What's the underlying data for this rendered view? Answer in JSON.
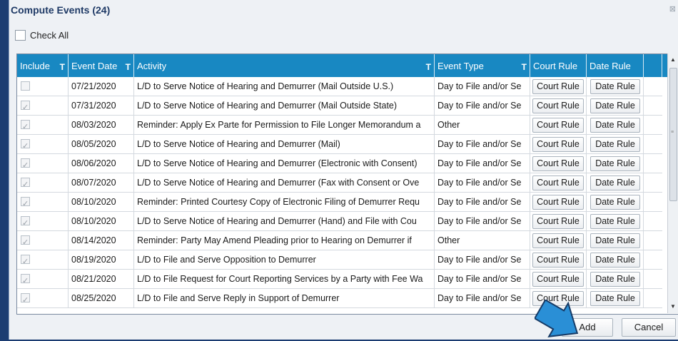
{
  "dialog": {
    "title": "Compute Events (24)",
    "close_glyph": "⊠"
  },
  "check_all": {
    "label": "Check All",
    "checked": false
  },
  "grid": {
    "columns": [
      {
        "label": "Include",
        "filter": "T"
      },
      {
        "label": "Event Date",
        "filter": "T"
      },
      {
        "label": "Activity",
        "filter": "T"
      },
      {
        "label": "Event Type",
        "filter": "T"
      },
      {
        "label": "Court Rule",
        "filter": ""
      },
      {
        "label": "Date Rule",
        "filter": ""
      }
    ],
    "rows": [
      {
        "include": false,
        "date": "07/21/2020",
        "activity": "L/D to Serve Notice of Hearing and Demurrer (Mail Outside U.S.)",
        "type": "Day to File and/or Se",
        "court_rule": "Court Rule",
        "date_rule": "Date Rule"
      },
      {
        "include": true,
        "date": "07/31/2020",
        "activity": "L/D to Serve Notice of Hearing and Demurrer (Mail Outside State)",
        "type": "Day to File and/or Se",
        "court_rule": "Court Rule",
        "date_rule": "Date Rule"
      },
      {
        "include": true,
        "date": "08/03/2020",
        "activity": "Reminder: Apply Ex Parte for Permission to File Longer Memorandum a",
        "type": "Other",
        "court_rule": "Court Rule",
        "date_rule": "Date Rule"
      },
      {
        "include": true,
        "date": "08/05/2020",
        "activity": "L/D to Serve Notice of Hearing and Demurrer (Mail)",
        "type": "Day to File and/or Se",
        "court_rule": "Court Rule",
        "date_rule": "Date Rule"
      },
      {
        "include": true,
        "date": "08/06/2020",
        "activity": "L/D to Serve Notice of Hearing and Demurrer (Electronic with Consent)",
        "type": "Day to File and/or Se",
        "court_rule": "Court Rule",
        "date_rule": "Date Rule"
      },
      {
        "include": true,
        "date": "08/07/2020",
        "activity": "L/D to Serve Notice of Hearing and Demurrer (Fax with Consent or Ove",
        "type": "Day to File and/or Se",
        "court_rule": "Court Rule",
        "date_rule": "Date Rule"
      },
      {
        "include": true,
        "date": "08/10/2020",
        "activity": "Reminder: Printed Courtesy Copy of Electronic Filing of Demurrer Requ",
        "type": "Day to File and/or Se",
        "court_rule": "Court Rule",
        "date_rule": "Date Rule"
      },
      {
        "include": true,
        "date": "08/10/2020",
        "activity": "L/D to Serve Notice of Hearing and Demurrer (Hand) and File with Cou",
        "type": "Day to File and/or Se",
        "court_rule": "Court Rule",
        "date_rule": "Date Rule"
      },
      {
        "include": true,
        "date": "08/14/2020",
        "activity": "Reminder: Party May Amend Pleading prior to Hearing on Demurrer if",
        "type": "Other",
        "court_rule": "Court Rule",
        "date_rule": "Date Rule"
      },
      {
        "include": true,
        "date": "08/19/2020",
        "activity": "L/D to File and Serve Opposition to Demurrer",
        "type": "Day to File and/or Se",
        "court_rule": "Court Rule",
        "date_rule": "Date Rule"
      },
      {
        "include": true,
        "date": "08/21/2020",
        "activity": "L/D to File Request for Court Reporting Services by a Party with Fee Wa",
        "type": "Day to File and/or Se",
        "court_rule": "Court Rule",
        "date_rule": "Date Rule"
      },
      {
        "include": true,
        "date": "08/25/2020",
        "activity": "L/D to File and Serve Reply in Support of Demurrer",
        "type": "Day to File and/or Se",
        "court_rule": "Court Rule",
        "date_rule": "Date Rule"
      }
    ]
  },
  "scrollbar": {
    "up_glyph": "▲",
    "down_glyph": "▼",
    "grip_glyph": "≡"
  },
  "footer": {
    "add_label": "Add",
    "cancel_label": "Cancel"
  },
  "colors": {
    "header_bg": "#1888c2",
    "arrow_fill": "#2a8fd6",
    "window_bg": "#1c3d72"
  }
}
